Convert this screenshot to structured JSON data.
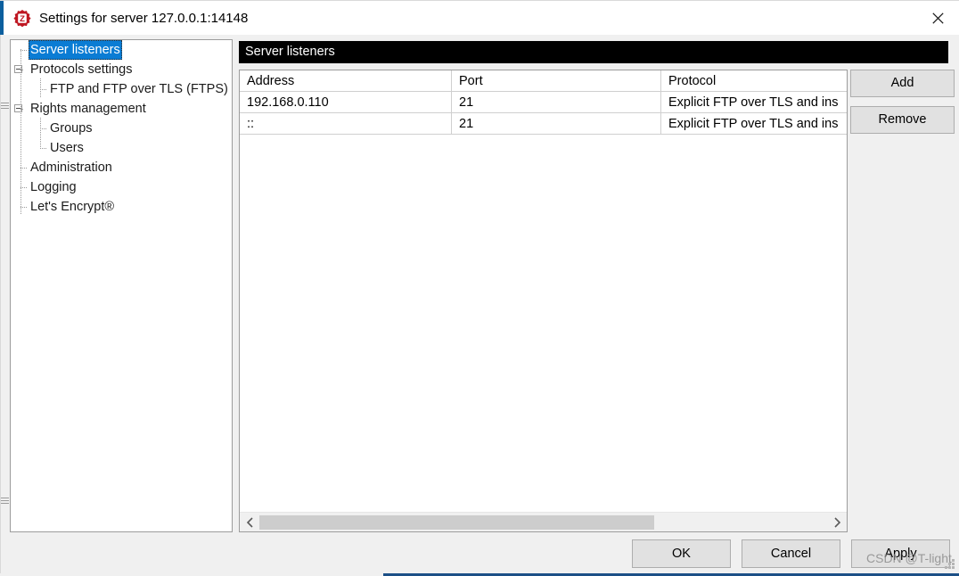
{
  "window": {
    "title": "Settings for server 127.0.0.1:14148",
    "app_icon": "filezilla-icon",
    "close_icon": "close-icon",
    "accent_color": "#0c5f9e"
  },
  "sidebar": {
    "items": [
      {
        "label": "Server listeners",
        "depth": 0,
        "selected": true,
        "expander": false
      },
      {
        "label": "Protocols settings",
        "depth": 0,
        "selected": false,
        "expander": true
      },
      {
        "label": "FTP and FTP over TLS (FTPS)",
        "depth": 1,
        "selected": false,
        "expander": false
      },
      {
        "label": "Rights management",
        "depth": 0,
        "selected": false,
        "expander": true
      },
      {
        "label": "Groups",
        "depth": 1,
        "selected": false,
        "expander": false
      },
      {
        "label": "Users",
        "depth": 1,
        "selected": false,
        "expander": false
      },
      {
        "label": "Administration",
        "depth": 0,
        "selected": false,
        "expander": false
      },
      {
        "label": "Logging",
        "depth": 0,
        "selected": false,
        "expander": false
      },
      {
        "label": "Let's Encrypt®",
        "depth": 0,
        "selected": false,
        "expander": false
      }
    ],
    "selected_color": "#0a7cd4"
  },
  "content": {
    "header": "Server listeners",
    "header_bg": "#000000",
    "table": {
      "columns": [
        "Address",
        "Port",
        "Protocol"
      ],
      "rows": [
        {
          "address": "192.168.0.110",
          "port": "21",
          "protocol": "Explicit FTP over TLS and ins"
        },
        {
          "address": "::",
          "port": "21",
          "protocol": "Explicit FTP over TLS and ins"
        }
      ]
    },
    "scrollbar": {
      "left_arrow_icon": "chevron-left-icon",
      "right_arrow_icon": "chevron-right-icon",
      "thumb_ratio": "0.65"
    }
  },
  "side_buttons": {
    "add_label": "Add",
    "remove_label": "Remove"
  },
  "bottom_buttons": {
    "ok_label": "OK",
    "cancel_label": "Cancel",
    "apply_label": "Apply"
  },
  "watermark": {
    "text": "CSDN @T-light"
  }
}
